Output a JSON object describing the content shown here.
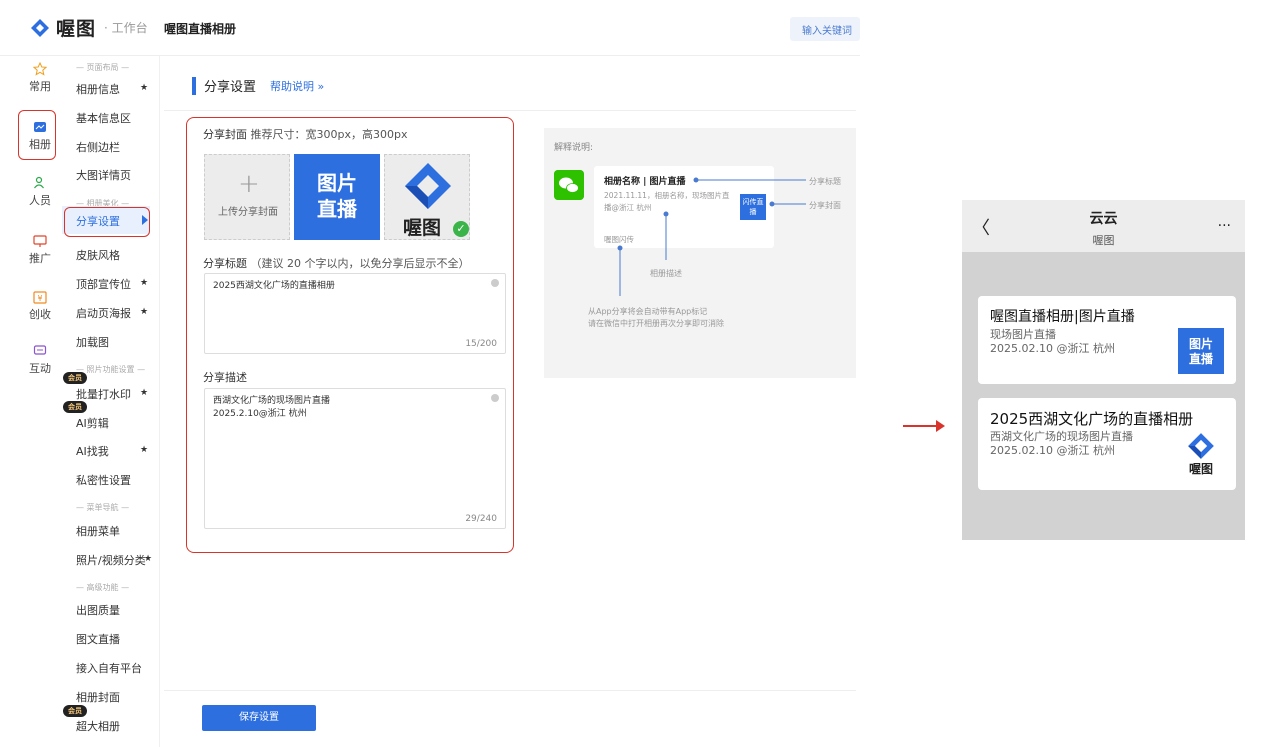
{
  "header": {
    "logo_text": "喔图",
    "logo_sub": "· 工作台",
    "album_title": "喔图直播相册",
    "search_placeholder": "输入关键词"
  },
  "rail": [
    {
      "label": "常用",
      "icon": "star-icon"
    },
    {
      "label": "相册",
      "icon": "album-icon"
    },
    {
      "label": "人员",
      "icon": "people-icon"
    },
    {
      "label": "推广",
      "icon": "promote-icon"
    },
    {
      "label": "创收",
      "icon": "revenue-icon"
    },
    {
      "label": "互动",
      "icon": "chat-icon"
    }
  ],
  "submenu": {
    "groups": [
      "— 页面布局 —",
      "— 相册美化 —",
      "— 照片功能设置 —",
      "— 菜单导航 —",
      "— 高级功能 —"
    ],
    "items": [
      "相册信息",
      "基本信息区",
      "右侧边栏",
      "大图详情页",
      "分享设置",
      "皮肤风格",
      "顶部宣传位",
      "启动页海报",
      "加载图",
      "批量打水印",
      "AI剪辑",
      "AI找我",
      "私密性设置",
      "相册菜单",
      "照片/视频分类",
      "出图质量",
      "图文直播",
      "接入自有平台",
      "相册封面",
      "超大相册"
    ],
    "star": "★",
    "badge": "会员"
  },
  "main": {
    "title": "分享设置",
    "help": "帮助说明 »",
    "cover_label": "分享封面",
    "cover_hint": "推荐尺寸：宽300px，高300px",
    "upload_text": "上传分享封面",
    "upload_plus": "+",
    "cover_blue_text": "图片直播",
    "cover_logo_text": "喔图",
    "check": "✓",
    "title_label": "分享标题",
    "title_hint": "（建议 20 个字以内，以免分享后显示不全）",
    "title_value": "2025西湖文化广场的直播相册",
    "title_count": "15/200",
    "desc_label": "分享描述",
    "desc_value": "西湖文化广场的现场图片直播\n2025.2.10@浙江 杭州",
    "desc_count": "29/240",
    "save": "保存设置"
  },
  "explain": {
    "title": "解释说明:",
    "card_title": "相册名称 | 图片直播",
    "card_desc": "2021.11.11，相册名称，现场图片直播@浙江 杭州",
    "card_thumb": "闪传直播",
    "card_src": "喔图闪传",
    "note_share_title": "分享标题",
    "note_share_cover": "分享封面",
    "note_album_desc": "相册描述",
    "note_app_1": "从App分享将会自动带有App标记",
    "note_app_2": "请在微信中打开相册再次分享即可消除"
  },
  "phone": {
    "back": "〈",
    "name": "云云",
    "sub": "喔图",
    "more": "···",
    "msgs": [
      {
        "title": "喔图直播相册|图片直播",
        "desc1": "现场图片直播",
        "desc2": "2025.02.10 @浙江 杭州",
        "thumb": "图片直播"
      },
      {
        "title": "2025西湖文化广场的直播相册",
        "desc1": "西湖文化广场的现场图片直播",
        "desc2": "2025.02.10 @浙江 杭州",
        "thumb": "喔图"
      }
    ]
  },
  "colors": {
    "accent": "#2e6fe0",
    "highlight": "#d9342b",
    "wechat": "#2dc100"
  }
}
